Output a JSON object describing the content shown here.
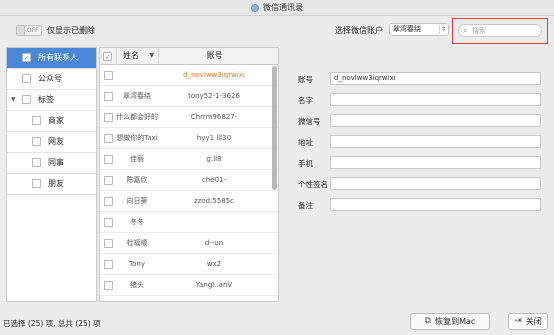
{
  "window": {
    "title": "微信通讯录"
  },
  "toolbar": {
    "toggle_text": "OFF",
    "only_deleted_label": "仅显示已删除",
    "account_label": "选择微信账户",
    "account_value": "翠湾春绕",
    "search_placeholder": "搜索"
  },
  "sidebar": {
    "items": [
      {
        "label": "所有联系人",
        "checked": true,
        "active": true
      },
      {
        "label": "公众号"
      },
      {
        "label": "标签"
      },
      {
        "label": "商家"
      },
      {
        "label": "网友"
      },
      {
        "label": "同事"
      },
      {
        "label": "朋友"
      }
    ]
  },
  "list": {
    "col_name": "姓名",
    "col_account": "账号",
    "rows": [
      {
        "name": "",
        "account": "d_novlww3iqrwixi"
      },
      {
        "name": "翠湾春绕",
        "account": "tony52-1-3626"
      },
      {
        "name": "什么都会好的",
        "account": "Chrrm96827-"
      },
      {
        "name": "想做你的Taxi",
        "account": "hyy1 lll30"
      },
      {
        "name": "佳丽",
        "account": "g:ll8"
      },
      {
        "name": "陈嘉欣",
        "account": "che01-"
      },
      {
        "name": "向日葵",
        "account": "zzod:5585c"
      },
      {
        "name": "冬冬",
        "account": ""
      },
      {
        "name": "杜福顺",
        "account": "d--un"
      },
      {
        "name": "Tony",
        "account": "wx2"
      },
      {
        "name": "猪头",
        "account": "Yangl..anV"
      }
    ]
  },
  "form": {
    "fields": [
      {
        "label": "账号",
        "value": "d_novlww3iqrwixi"
      },
      {
        "label": "名字",
        "value": ""
      },
      {
        "label": "微信号",
        "value": ""
      },
      {
        "label": "地址",
        "value": ""
      },
      {
        "label": "手机",
        "value": ""
      },
      {
        "label": "个性签名",
        "value": ""
      },
      {
        "label": "备注",
        "value": ""
      }
    ]
  },
  "footer": {
    "status": "已选择 (25) 项, 总共 (25) 项",
    "restore_label": "恢复到Mac",
    "close_label": "关闭"
  },
  "colors": {
    "accent": "#4a88d7",
    "highlight": "#e53b3b",
    "account_orange": "#e07a2d"
  }
}
